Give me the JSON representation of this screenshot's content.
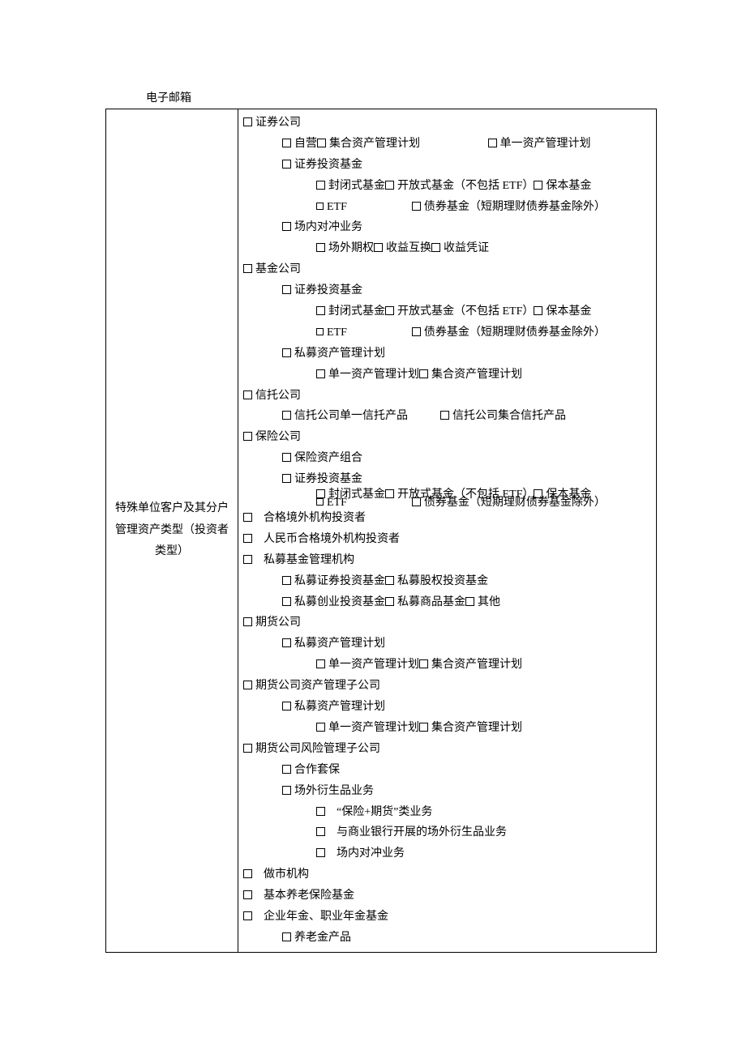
{
  "email_label": "电子邮箱",
  "row_label_l1": "特殊单位客户及其分户",
  "row_label_l2": "管理资产类型（投资者",
  "row_label_l3": "类型）",
  "t": {
    "sec_co": "证券公司",
    "self_op": "自营",
    "pooled_plan": "集合资产管理计划",
    "single_plan": "单一资产管理计划",
    "sec_inv_fund": "证券投资基金",
    "closed_fund": "封闭式基金",
    "open_fund": "开放式基金（不包括 ETF）",
    "cap_pres": "保本基金",
    "etf": "ETF",
    "bond_fund": "债券基金（短期理财债券基金除外）",
    "onsite_hedge": "场内对冲业务",
    "otc_opt": "场外期权",
    "return_swap": "收益互换",
    "return_cert": "收益凭证",
    "fund_co": "基金公司",
    "priv_plan": "私募资产管理计划",
    "single_amplan": "单一资产管理计划",
    "pooled_amplan": "集合资产管理计划",
    "trust_co": "信托公司",
    "trust_single": "信托公司单一信托产品",
    "trust_pooled": "信托公司集合信托产品",
    "ins_co": "保险公司",
    "ins_port": "保险资产组合",
    "qfii": "合格境外机构投资者",
    "rqfii": "人民币合格境外机构投资者",
    "pe_mgr": "私募基金管理机构",
    "pe_sec": "私募证券投资基金",
    "pe_equity": "私募股权投资基金",
    "pe_venture": "私募创业投资基金",
    "pe_comm": "私募商品基金",
    "other": "其他",
    "fut_co": "期货公司",
    "fut_am_sub": "期货公司资产管理子公司",
    "fut_risk_sub": "期货公司风险管理子公司",
    "coop_hedge": "合作套保",
    "otc_deriv": "场外衍生品业务",
    "ins_fut": "“保险+期货”类业务",
    "bank_otc": "与商业银行开展的场外衍生品业务",
    "onsite_hedge2": "场内对冲业务",
    "mm": "做市机构",
    "basic_pension": "基本养老保险基金",
    "ent_annuity": "企业年金、职业年金基金",
    "pension_prod": "养老金产品"
  }
}
